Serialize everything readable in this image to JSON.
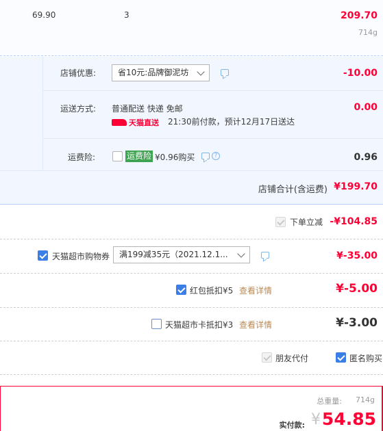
{
  "item": {
    "unit_price": "69.90",
    "quantity": "3",
    "subtotal": "209.70",
    "weight": "714g"
  },
  "shop": {
    "discount_label": "店铺优惠:",
    "discount_select": "省10元:品牌御泥坊",
    "discount_amount": "-10.00",
    "shipping_label": "运送方式:",
    "shipping_method": "普通配送 快递 免邮",
    "shipping_brand": "天猫直送",
    "shipping_eta": "21:30前付款，预计12月17日送达",
    "shipping_amount": "0.00",
    "insurance_label": "运费险:",
    "insurance_tag": "运费险",
    "insurance_price": "¥0.96购买",
    "insurance_amount": "0.96",
    "total_label": "店铺合计(含运费)",
    "total_amount": "¥199.70"
  },
  "instant_discount": {
    "label": "下单立减",
    "amount": "-¥104.85"
  },
  "coupon": {
    "label": "天猫超市购物券",
    "select": "满199减35元（2021.12.1...",
    "amount": "¥-35.00"
  },
  "red_packet": {
    "label": "红包抵扣¥5",
    "detail": "查看详情",
    "amount": "¥-5.00"
  },
  "market_card": {
    "label": "天猫超市卡抵扣¥3",
    "detail": "查看详情",
    "amount": "¥-3.00"
  },
  "options": {
    "friend_pay": "朋友代付",
    "anonymous": "匿名购买"
  },
  "summary": {
    "weight_label": "总重量:",
    "weight_value": "714g",
    "pay_label": "实付款:",
    "currency": "¥",
    "pay_amount": "54.85"
  },
  "colors": {
    "accent_red": "#ff0036",
    "checkbox_blue": "#3a7ee6",
    "insurance_green": "#3fa452",
    "link_brown": "#b98a56"
  }
}
